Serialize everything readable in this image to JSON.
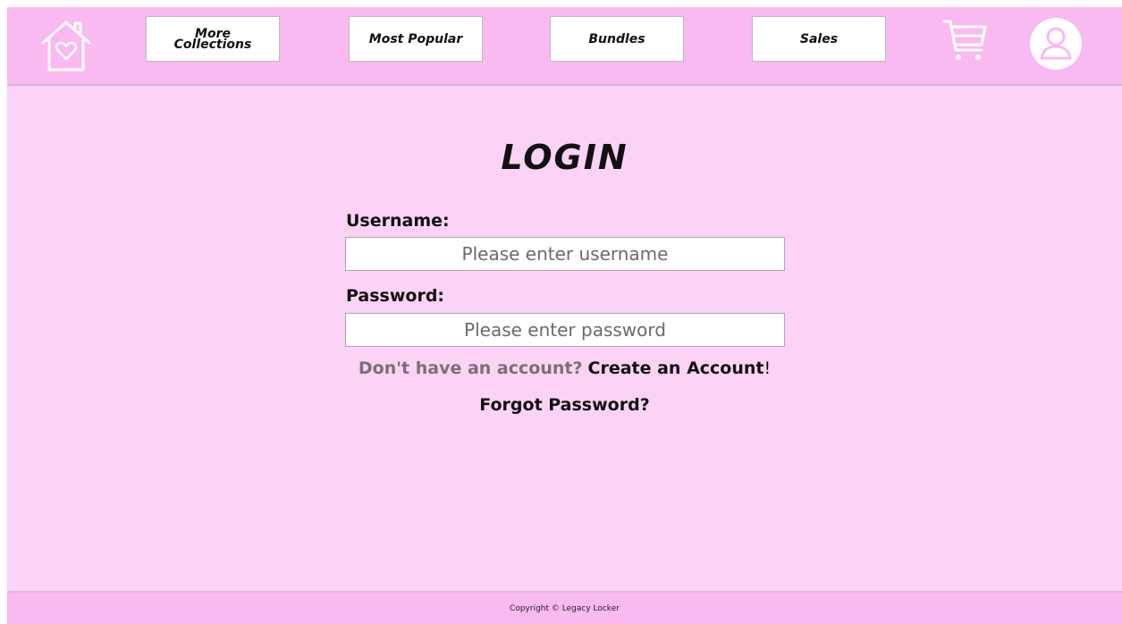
{
  "header": {
    "home_icon": "home-heart-icon",
    "cart_icon": "shopping-cart-icon",
    "account_icon": "user-avatar-icon",
    "nav": {
      "more_collections": "More\nCollections",
      "most_popular": "Most Popular",
      "bundles": "Bundles",
      "sales": "Sales"
    }
  },
  "login": {
    "title": "LOGIN",
    "username_label": "Username:",
    "username_placeholder": "Please enter username",
    "password_label": "Password:",
    "password_placeholder": "Please enter password",
    "signup_prompt": "Don't have an account?",
    "create_account_link": "Create an Account",
    "signup_exclaim": "!",
    "forgot_password_link": "Forgot Password?"
  },
  "footer": {
    "copyright": "Copyright © Legacy Locker"
  },
  "colors": {
    "header_bg": "#f9b9f1",
    "page_bg": "#fcd2f6",
    "button_bg": "#ffffff",
    "text_dark": "#111111",
    "text_muted": "#7a6f78"
  }
}
